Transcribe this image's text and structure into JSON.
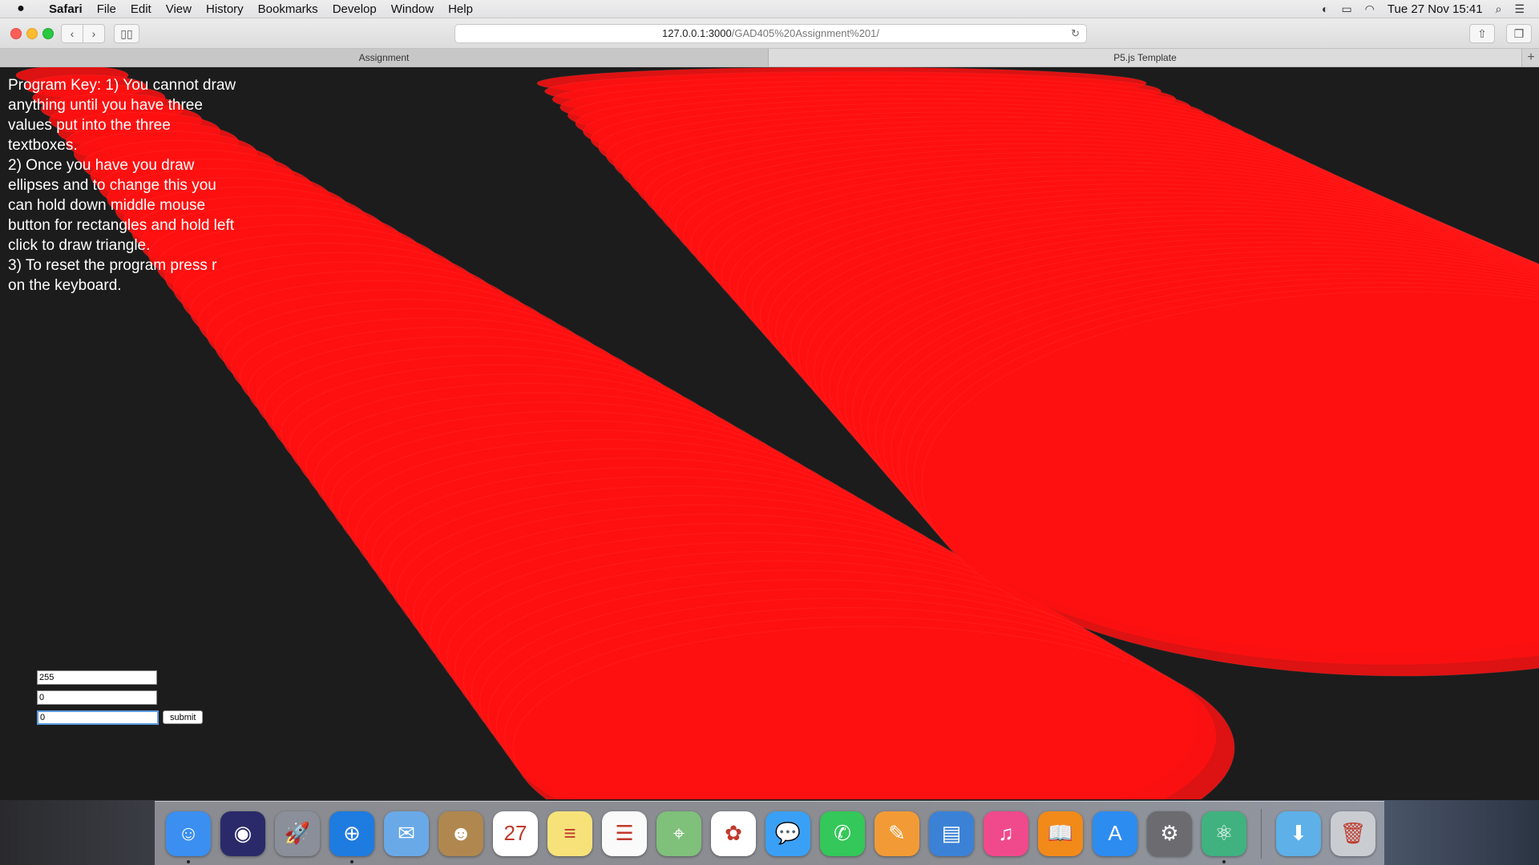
{
  "menubar": {
    "app_name": "Safari",
    "items": [
      "File",
      "Edit",
      "View",
      "History",
      "Bookmarks",
      "Develop",
      "Window",
      "Help"
    ],
    "clock": "Tue 27 Nov  15:41"
  },
  "toolbar": {
    "url_host": "127.0.0.1:3000",
    "url_path": "/GAD405%20Assignment%201/"
  },
  "tabs": [
    {
      "label": "Assignment"
    },
    {
      "label": "P5.js Template"
    }
  ],
  "page": {
    "instructions": "Program Key: 1) You cannot draw anything until you have three values put into the three textboxes.\n2) Once you have you draw ellipses and to change this you can hold down middle mouse button for rectangles and hold left click to draw triangle.\n3) To reset the program press r on the keyboard.",
    "fields": {
      "r": "255",
      "g": "0",
      "b": "0"
    },
    "submit_label": "submit",
    "stroke_color": "#ff1010"
  },
  "dock": {
    "icons": [
      {
        "name": "finder-icon",
        "glyph": "☺",
        "bg": "#3b8ff0",
        "running": true
      },
      {
        "name": "siri-icon",
        "glyph": "◉",
        "bg": "#2a2a6a",
        "running": false
      },
      {
        "name": "launchpad-icon",
        "glyph": "🚀",
        "bg": "#8a8f99",
        "running": false
      },
      {
        "name": "safari-icon",
        "glyph": "⊕",
        "bg": "#1e7be0",
        "running": true
      },
      {
        "name": "mail-icon",
        "glyph": "✉",
        "bg": "#6aa9e8",
        "running": false
      },
      {
        "name": "contacts-icon",
        "glyph": "☻",
        "bg": "#b0874f",
        "running": false
      },
      {
        "name": "calendar-icon",
        "glyph": "27",
        "bg": "#ffffff",
        "running": false
      },
      {
        "name": "notes-icon",
        "glyph": "≡",
        "bg": "#f7e27a",
        "running": false
      },
      {
        "name": "reminders-icon",
        "glyph": "☰",
        "bg": "#fafafa",
        "running": false
      },
      {
        "name": "maps-icon",
        "glyph": "⌖",
        "bg": "#7fc07a",
        "running": false
      },
      {
        "name": "photos-icon",
        "glyph": "✿",
        "bg": "#ffffff",
        "running": false
      },
      {
        "name": "messages-icon",
        "glyph": "💬",
        "bg": "#3aa0f5",
        "running": false
      },
      {
        "name": "facetime-icon",
        "glyph": "✆",
        "bg": "#34c759",
        "running": false
      },
      {
        "name": "pages-icon",
        "glyph": "✎",
        "bg": "#f29b36",
        "running": false
      },
      {
        "name": "keynote-icon",
        "glyph": "▤",
        "bg": "#3b82d6",
        "running": false
      },
      {
        "name": "itunes-icon",
        "glyph": "♫",
        "bg": "#f04a8c",
        "running": false
      },
      {
        "name": "ibooks-icon",
        "glyph": "📖",
        "bg": "#f28a1a",
        "running": false
      },
      {
        "name": "app-store-icon",
        "glyph": "A",
        "bg": "#2d8cf0",
        "running": false
      },
      {
        "name": "system-preferences-icon",
        "glyph": "⚙",
        "bg": "#6b6b70",
        "running": false
      },
      {
        "name": "atom-icon",
        "glyph": "⚛",
        "bg": "#3fb27f",
        "running": true
      }
    ],
    "trailing": [
      {
        "name": "downloads-folder-icon",
        "glyph": "⬇",
        "bg": "#5db0e8"
      },
      {
        "name": "trash-icon",
        "glyph": "🗑",
        "bg": "#c9ccd1"
      }
    ]
  }
}
